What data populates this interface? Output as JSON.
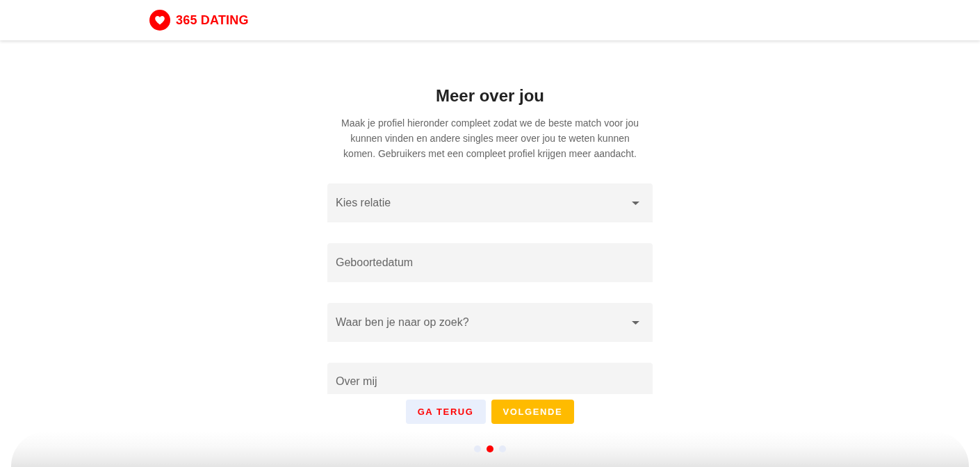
{
  "header": {
    "logo_text": "365 DATING"
  },
  "step": {
    "title": "Meer over jou",
    "description": "Maak je profiel hieronder compleet zodat we de beste match voor jou kunnen vinden en andere singles meer over jou te weten kunnen komen. Gebruikers met een compleet profiel krijgen meer aandacht."
  },
  "fields": [
    {
      "kind": "select",
      "placeholder": "Kies relatie"
    },
    {
      "kind": "date",
      "placeholder": "Geboortedatum"
    },
    {
      "kind": "select",
      "placeholder": "Waar ben je naar op zoek?"
    },
    {
      "kind": "textarea",
      "placeholder": "Over mij"
    }
  ],
  "buttons": [
    {
      "kind": "back",
      "label": "GA TERUG"
    },
    {
      "kind": "next",
      "label": "VOLGENDE"
    }
  ],
  "steps": [
    {
      "selected": false
    },
    {
      "selected": true
    },
    {
      "selected": false
    }
  ]
}
